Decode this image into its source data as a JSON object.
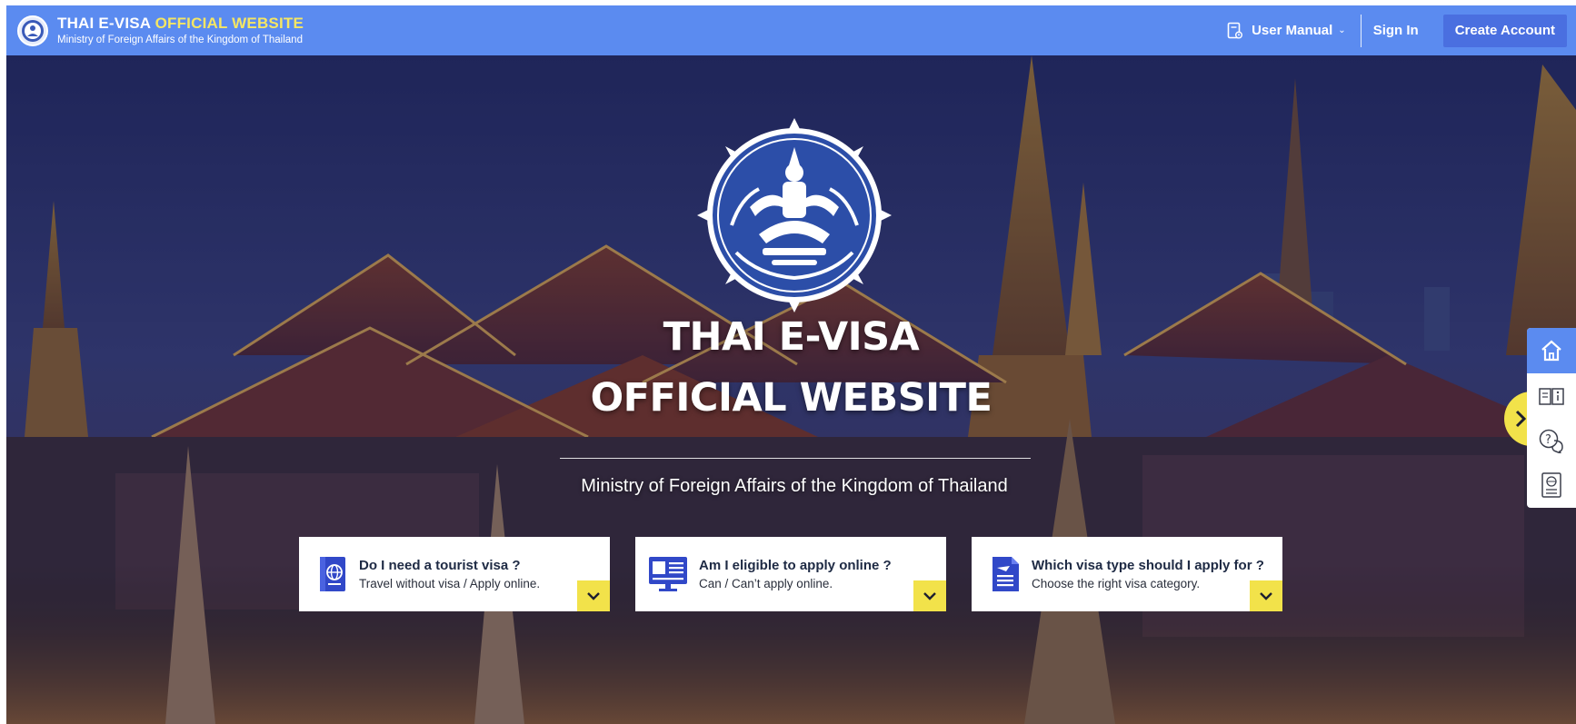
{
  "header": {
    "title_part1": "THAI E-VISA",
    "title_part2": "OFFICIAL WEBSITE",
    "subtitle": "Ministry of Foreign Affairs of the Kingdom of Thailand",
    "logo_icon": "thai-emblem-icon",
    "nav": {
      "user_manual": "User Manual",
      "sign_in": "Sign In",
      "create_account": "Create Account"
    }
  },
  "hero": {
    "title_line1": "THAI E-VISA",
    "title_line2": "OFFICIAL WEBSITE",
    "ministry": "Ministry of Foreign Affairs of the Kingdom of Thailand"
  },
  "cards": [
    {
      "question": "Do I need a tourist visa ?",
      "answer": "Travel without visa / Apply online.",
      "icon": "passport-icon"
    },
    {
      "question": "Am I eligible to apply online ?",
      "answer": "Can / Can’t apply online.",
      "icon": "computer-screen-icon"
    },
    {
      "question": "Which visa type should I apply for ?",
      "answer": "Choose the right visa category.",
      "icon": "document-icon"
    }
  ],
  "side_toolbar": [
    "home-icon",
    "info-book-icon",
    "help-chat-icon",
    "visa-document-icon"
  ],
  "colors": {
    "header_bg": "#5b8bf0",
    "accent_yellow": "#f5e663",
    "create_button": "#4a6fe0",
    "hero_bg": "#2a2f6a"
  }
}
